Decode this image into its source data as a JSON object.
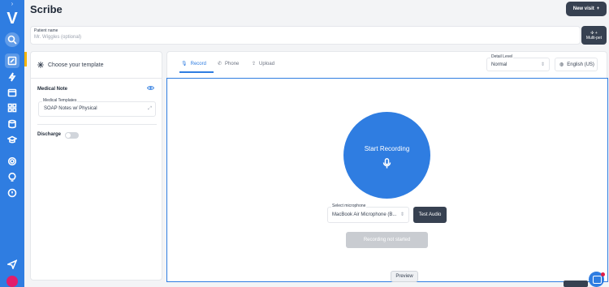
{
  "app": {
    "title": "Scribe",
    "logo_letter": "V",
    "new_visit_label": "New visit",
    "brand_color": "#2f7de1"
  },
  "sidebar": {
    "items": [
      {
        "icon": "search-icon"
      },
      {
        "icon": "edit-icon"
      },
      {
        "icon": "bolt-icon"
      },
      {
        "icon": "calendar-icon"
      },
      {
        "icon": "grid-icon"
      },
      {
        "icon": "database-icon"
      },
      {
        "icon": "graduation-cap-icon"
      },
      {
        "icon": "gear-icon"
      },
      {
        "icon": "lightbulb-icon"
      },
      {
        "icon": "help-icon"
      },
      {
        "icon": "send-icon"
      }
    ]
  },
  "patient": {
    "label": "Patient name",
    "placeholder": "Mr. Wiggles (optional)",
    "multipet_label": "Multi-pet"
  },
  "template_panel": {
    "header": "Choose your template",
    "section_medical": "Medical Note",
    "medical_templates_label": "Medical Templates",
    "medical_templates_value": "SOAP Notes w/ Physical",
    "section_discharge": "Discharge",
    "discharge_enabled": false
  },
  "recorder": {
    "tabs": [
      {
        "label": "Record",
        "icon": "mic-icon",
        "active": true
      },
      {
        "label": "Phone",
        "icon": "phone-icon",
        "active": false
      },
      {
        "label": "Upload",
        "icon": "upload-icon",
        "active": false
      }
    ],
    "detail_level_label": "Detail Level",
    "detail_level_value": "Normal",
    "language_value": "English (US)",
    "start_label": "Start Recording",
    "microphone_label": "Select microphone",
    "microphone_value": "MacBook Air Microphone (B...",
    "test_audio_label": "Test Audio",
    "status_label": "Recording not started",
    "preview_label": "Preview"
  }
}
